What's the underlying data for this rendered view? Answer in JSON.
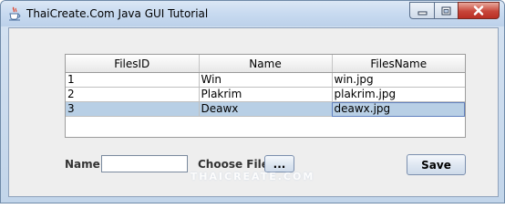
{
  "window": {
    "title": "ThaiCreate.Com Java GUI Tutorial",
    "controls": {
      "minimize": "minimize",
      "maximize": "maximize",
      "close": "close"
    }
  },
  "table": {
    "columns": [
      "FilesID",
      "Name",
      "FilesName"
    ],
    "rows": [
      [
        "1",
        "Win",
        "win.jpg"
      ],
      [
        "2",
        "Plakrim",
        "plakrim.jpg"
      ],
      [
        "3",
        "Deawx",
        "deawx.jpg"
      ]
    ],
    "selected_row": 3
  },
  "form": {
    "name_label": "Name :",
    "name_value": "",
    "choose_file_label": "Choose File",
    "browse_button": "...",
    "save_button": "Save"
  },
  "watermark": "THAICREATE.COM",
  "icons": {
    "app": "java-cup-icon",
    "minimize": "minimize-icon",
    "maximize": "maximize-icon",
    "close": "close-icon"
  },
  "colors": {
    "selection": "#b8cfe5",
    "close_button": "#c7463a",
    "titlebar": "#c8daf0"
  }
}
